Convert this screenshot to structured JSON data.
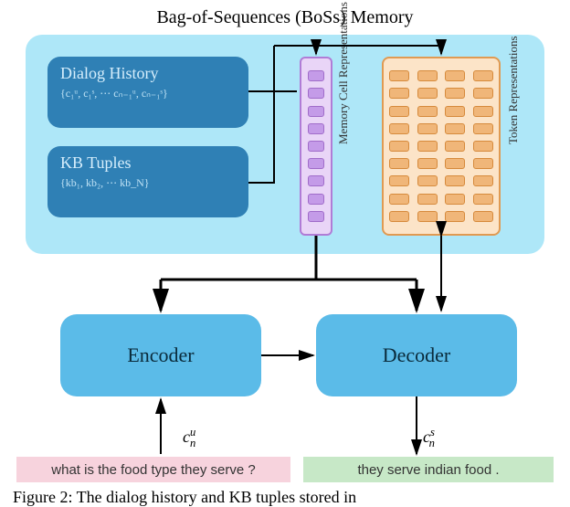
{
  "title": "Bag-of-Sequences (BoSs) Memory",
  "sources": {
    "dialog": {
      "title": "Dialog History",
      "sub": "{c₁ᵘ, c₁ˢ, ⋯ cₙ₋₁ᵘ, cₙ₋₁ˢ}"
    },
    "kb": {
      "title": "KB Tuples",
      "sub": "{kb₁, kb₂, ⋯ kb_N}"
    }
  },
  "labels": {
    "memcell": "Memory Cell Representations",
    "tokens": "Token Representations",
    "encoder": "Encoder",
    "decoder": "Decoder"
  },
  "io": {
    "user": "what is the food type they serve ?",
    "system": "they serve indian food .",
    "cnu_html": "c<span class='sup'>u</span><span class='sub' style='margin-left:-0.5em'>n</span>",
    "cns_html": "c<span class='sup'>s</span><span class='sub' style='margin-left:-0.5em'>n</span>"
  },
  "caption": "Figure 2: The dialog history and KB tuples stored in"
}
